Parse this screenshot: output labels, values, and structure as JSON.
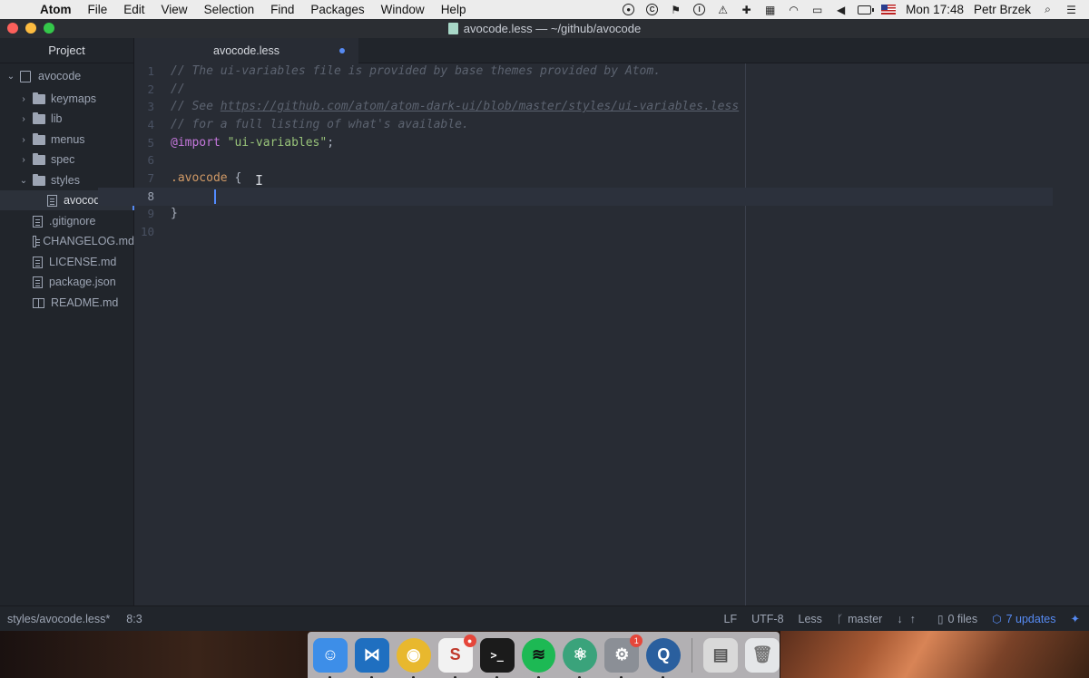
{
  "menubar": {
    "app_name": "Atom",
    "items": [
      "File",
      "Edit",
      "View",
      "Selection",
      "Find",
      "Packages",
      "Window",
      "Help"
    ],
    "clock": "Mon 17:48",
    "user": "Petr Brzek"
  },
  "window": {
    "title": "avocode.less — ~/github/avocode"
  },
  "sidebar": {
    "title": "Project",
    "tree": [
      {
        "label": "avocode",
        "kind": "root",
        "expanded": true,
        "depth": 0
      },
      {
        "label": "keymaps",
        "kind": "folder",
        "expanded": false,
        "depth": 1
      },
      {
        "label": "lib",
        "kind": "folder",
        "expanded": false,
        "depth": 1
      },
      {
        "label": "menus",
        "kind": "folder",
        "expanded": false,
        "depth": 1
      },
      {
        "label": "spec",
        "kind": "folder",
        "expanded": false,
        "depth": 1
      },
      {
        "label": "styles",
        "kind": "folder",
        "expanded": true,
        "depth": 1
      },
      {
        "label": "avocode.less",
        "kind": "file",
        "selected": true,
        "depth": 2
      },
      {
        "label": ".gitignore",
        "kind": "file",
        "depth": 1
      },
      {
        "label": "CHANGELOG.md",
        "kind": "file",
        "depth": 1
      },
      {
        "label": "LICENSE.md",
        "kind": "file",
        "depth": 1
      },
      {
        "label": "package.json",
        "kind": "file",
        "depth": 1
      },
      {
        "label": "README.md",
        "kind": "book",
        "depth": 1
      }
    ]
  },
  "tab": {
    "label": "avocode.less",
    "modified": true
  },
  "editor": {
    "line_numbers": [
      "1",
      "2",
      "3",
      "4",
      "5",
      "6",
      "7",
      "8",
      "9",
      "10"
    ],
    "current_line": 8,
    "code": {
      "l1": "// The ui-variables file is provided by base themes provided by Atom.",
      "l2": "//",
      "l3_prefix": "// See ",
      "l3_url": "https://github.com/atom/atom-dark-ui/blob/master/styles/ui-variables.less",
      "l4": "// for a full listing of what's available.",
      "l5_kw": "@import",
      "l5_space": " ",
      "l5_str": "\"ui-variables\"",
      "l5_end": ";",
      "l7_cls": ".avocode",
      "l7_rest": " {",
      "l9": "}"
    }
  },
  "statusbar": {
    "path": "styles/avocode.less*",
    "position": "8:3",
    "line_ending": "LF",
    "encoding": "UTF-8",
    "grammar": "Less",
    "branch": "master",
    "files": "0 files",
    "updates": "7 updates"
  },
  "dock": {
    "apps": [
      {
        "name": "finder",
        "color": "#3d8ee8",
        "glyph": "☺"
      },
      {
        "name": "vscode",
        "color": "#1f6fc0",
        "glyph": "⋈"
      },
      {
        "name": "chrome",
        "color": "#e8b82e",
        "glyph": "◉"
      },
      {
        "name": "sketch",
        "color": "#f2f2f2",
        "glyph": "S",
        "badge": "●"
      },
      {
        "name": "terminal",
        "color": "#1b1b1b",
        "glyph": ">_"
      },
      {
        "name": "spotify",
        "color": "#1db954",
        "glyph": "≋"
      },
      {
        "name": "atom",
        "color": "#3aa37b",
        "glyph": "⚛"
      },
      {
        "name": "system-preferences",
        "color": "#8b8f96",
        "glyph": "⚙",
        "badge": "1"
      },
      {
        "name": "quicktime",
        "color": "#2a5f9e",
        "glyph": "Q"
      },
      {
        "name": "preview",
        "color": "#d9d9d9",
        "glyph": "▤"
      },
      {
        "name": "trash",
        "color": "#e4e6e8",
        "glyph": "🗑"
      }
    ],
    "badges": {
      "sketch": "●",
      "system_preferences": "1"
    }
  }
}
